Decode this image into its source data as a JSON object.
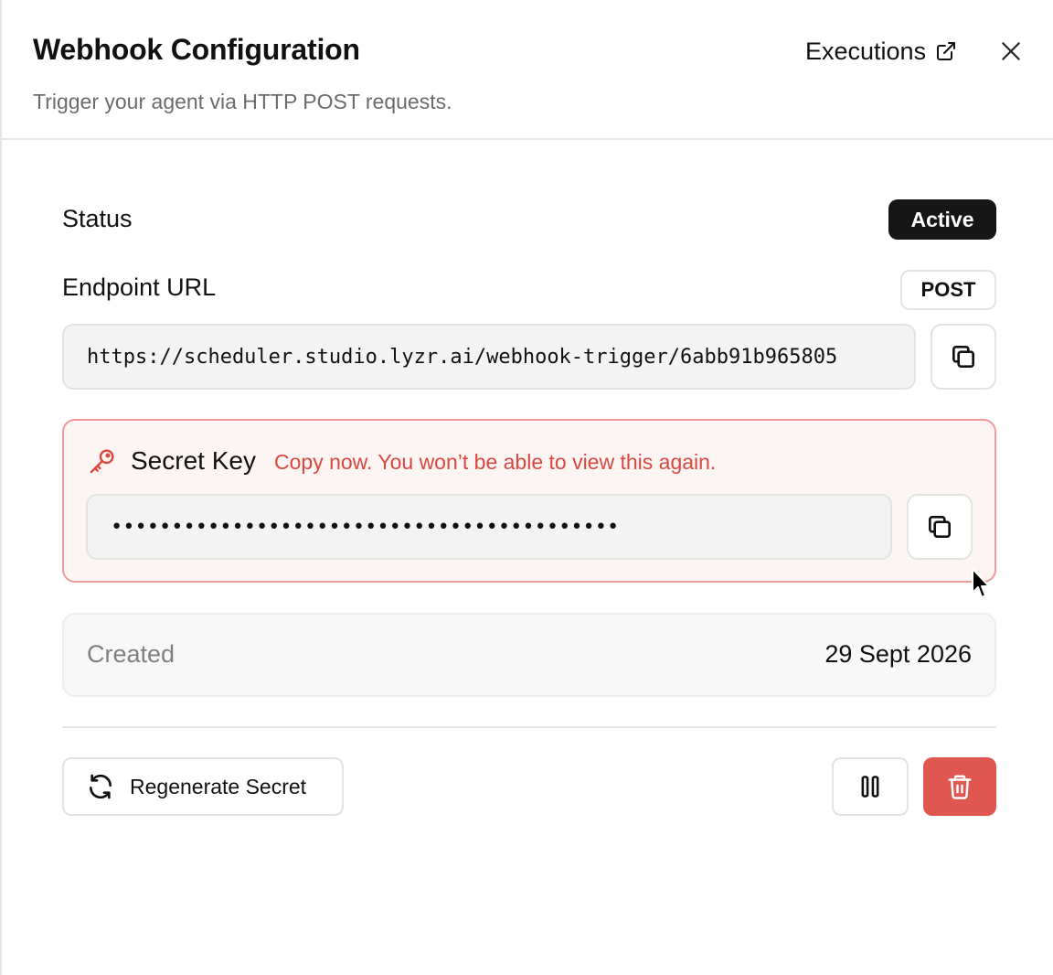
{
  "header": {
    "title": "Webhook Configuration",
    "subtitle": "Trigger your agent via HTTP POST requests.",
    "executions_label": "Executions",
    "executions_icon": "external-link-icon",
    "close_icon": "close-icon"
  },
  "status": {
    "label": "Status",
    "value": "Active"
  },
  "endpoint": {
    "label": "Endpoint URL",
    "method": "POST",
    "url": "https://scheduler.studio.lyzr.ai/webhook-trigger/6abb91b965805",
    "copy_icon": "copy-icon"
  },
  "secret": {
    "title": "Secret Key",
    "warning": "Copy now. You won’t be able to view this again.",
    "masked_value": "••••••••••••••••••••••••••••••••••••••••••",
    "key_icon": "key-icon",
    "copy_icon": "copy-icon",
    "accent_color": "#d9473f"
  },
  "created": {
    "label": "Created",
    "date": "29 Sept 2026"
  },
  "actions": {
    "regenerate_label": "Regenerate Secret",
    "regenerate_icon": "refresh-icon",
    "pause_icon": "pause-icon",
    "delete_icon": "trash-icon",
    "delete_color": "#e05650"
  }
}
